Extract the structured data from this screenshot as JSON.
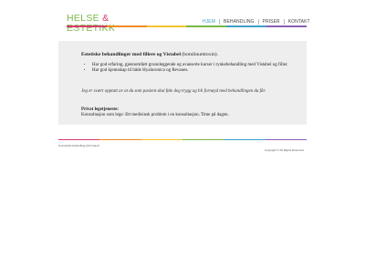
{
  "logo": {
    "word1": "HELSE",
    "amp": "&",
    "word2": "ESTETIKK"
  },
  "nav": [
    "HJEM",
    "BEHANDLING",
    "PRISER",
    "KONTAKT"
  ],
  "nav_active_index": 0,
  "colors": {
    "logo_green": "#7ab648",
    "logo_pink": "#d93a6a",
    "nav_active": "#3aa0c8",
    "panel_bg": "#eeeeee",
    "stripes": [
      "#d93a6a",
      "#f08a24",
      "#f4c430",
      "#7ab648",
      "#3aa0c8",
      "#8a5fb0"
    ]
  },
  "content": {
    "heading_bold": "Estetiske behandlinger med fillere og Vistabel",
    "heading_rest": " (botulinumtoxin).",
    "bullets": [
      "Har god erfaring, gjennomført grunnleggende og avanserte kurser i rynkebehandling med Vistabel og filler.",
      "Har god kjennskap til både Hyaluronica og Revanes."
    ],
    "italic_note": "Jeg er svært opptatt av at du som pasient skal føle deg trygg og bli fornøyd med behandlingen du får.",
    "private_title": "Privat legetjeneste:",
    "private_text": "Konsultasjon som lege: Ett medisinsk problem i en konsultasjon. Time på dagen."
  },
  "footer": {
    "left": "Kosmetisk behandling på fornøyd",
    "right": "Copyright © All Rights Reserved"
  }
}
